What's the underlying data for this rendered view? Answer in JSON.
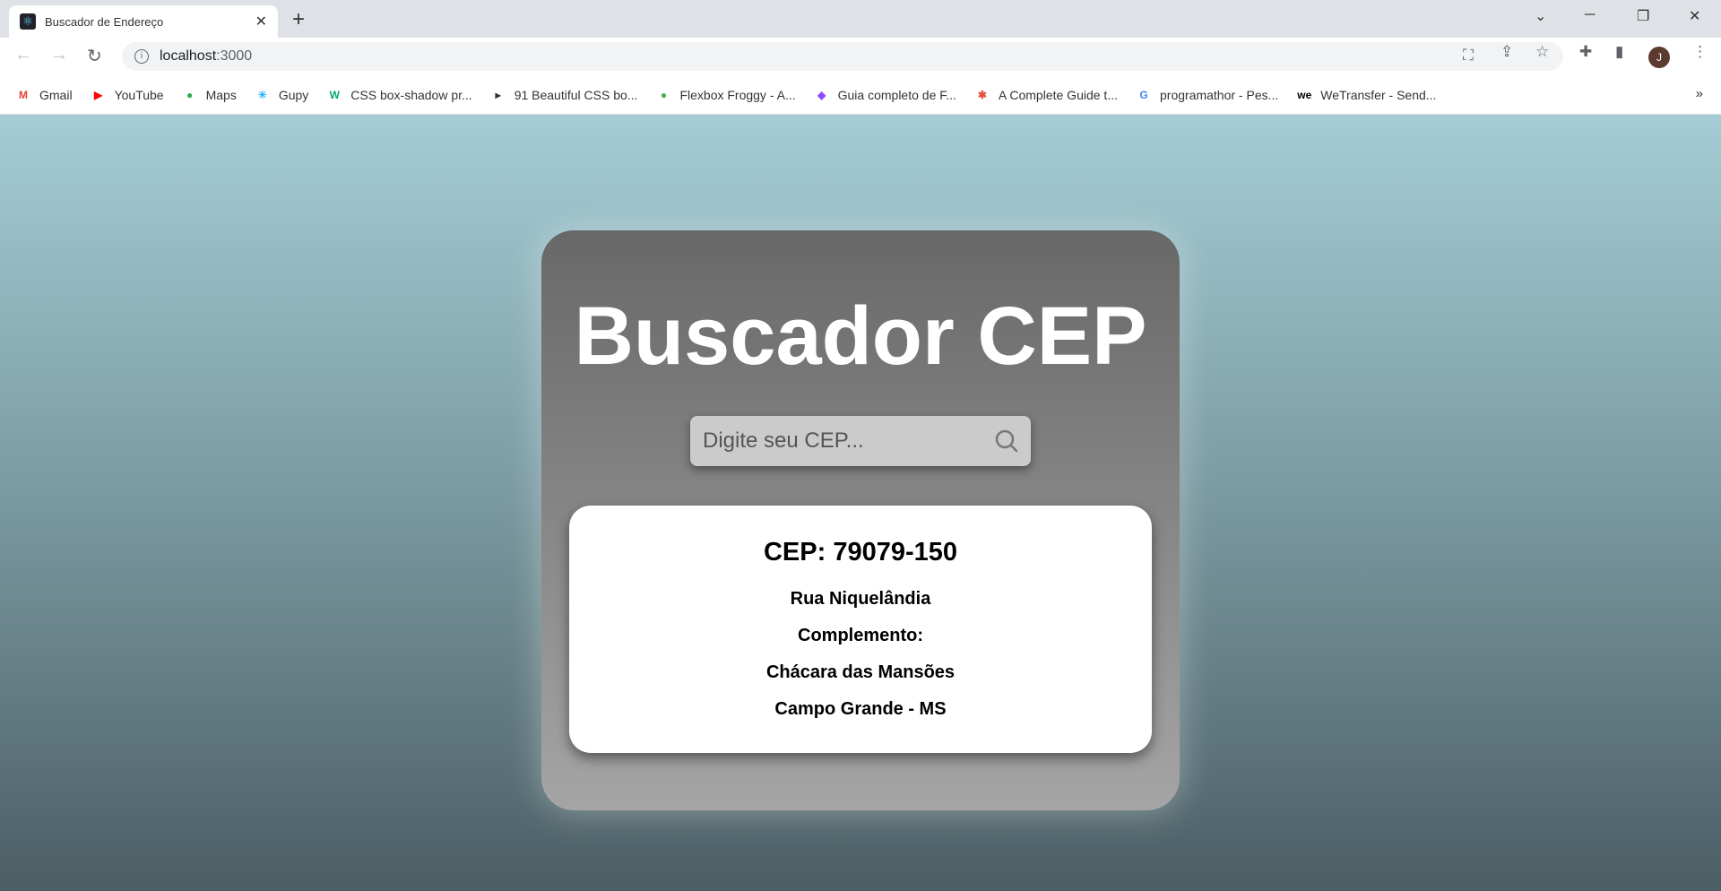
{
  "browser": {
    "tab_title": "Buscador de Endereço",
    "url_host": "localhost",
    "url_port": ":3000",
    "profile_initial": "J",
    "bookmarks": [
      {
        "label": "Gmail",
        "icon": "gmail-icon",
        "color": "#ea4335",
        "glyph": "M"
      },
      {
        "label": "YouTube",
        "icon": "youtube-icon",
        "color": "#ff0000",
        "glyph": "▶"
      },
      {
        "label": "Maps",
        "icon": "maps-icon",
        "color": "#34a853",
        "glyph": "●"
      },
      {
        "label": "Gupy",
        "icon": "gupy-icon",
        "color": "#29b6f6",
        "glyph": "✳"
      },
      {
        "label": "CSS box-shadow pr...",
        "icon": "w3-icon",
        "color": "#04aa6d",
        "glyph": "W"
      },
      {
        "label": "91 Beautiful CSS bo...",
        "icon": "cursor-icon",
        "color": "#333333",
        "glyph": "▸"
      },
      {
        "label": "Flexbox Froggy - A...",
        "icon": "frog-icon",
        "color": "#4caf50",
        "glyph": "●"
      },
      {
        "label": "Guia completo de F...",
        "icon": "origamid-icon",
        "color": "#8c4dff",
        "glyph": "◆"
      },
      {
        "label": "A Complete Guide t...",
        "icon": "css-tricks-icon",
        "color": "#e0533b",
        "glyph": "✱"
      },
      {
        "label": "programathor - Pes...",
        "icon": "google-icon",
        "color": "#4285f4",
        "glyph": "G"
      },
      {
        "label": "WeTransfer - Send...",
        "icon": "wetransfer-icon",
        "color": "#000000",
        "glyph": "we"
      }
    ]
  },
  "app": {
    "title": "Buscador CEP",
    "search_placeholder": "Digite seu CEP...",
    "result": {
      "cep": "CEP: 79079-150",
      "logradouro": "Rua Niquelândia",
      "complemento": "Complemento:",
      "bairro": "Chácara das Mansões",
      "cidade": "Campo Grande - MS"
    }
  }
}
